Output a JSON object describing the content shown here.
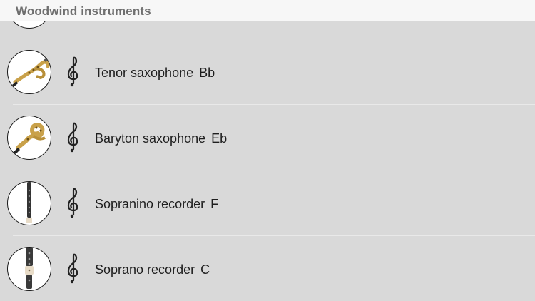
{
  "header": {
    "title": "Woodwind instruments"
  },
  "instruments": [
    {
      "name": "Tenor saxophone",
      "key": "Bb",
      "icon": "tenor-saxophone-icon",
      "clef": "treble-clef-icon"
    },
    {
      "name": "Baryton saxophone",
      "key": "Eb",
      "icon": "baritone-saxophone-icon",
      "clef": "treble-clef-icon"
    },
    {
      "name": "Sopranino recorder",
      "key": "F",
      "icon": "sopranino-recorder-icon",
      "clef": "treble-clef-icon"
    },
    {
      "name": "Soprano recorder",
      "key": "C",
      "icon": "soprano-recorder-icon",
      "clef": "treble-clef-icon"
    }
  ],
  "colors": {
    "background": "#d9d9d9",
    "header": "#f7f7f7",
    "header_text": "#6f6f6f",
    "brass": "#c9a14a"
  }
}
